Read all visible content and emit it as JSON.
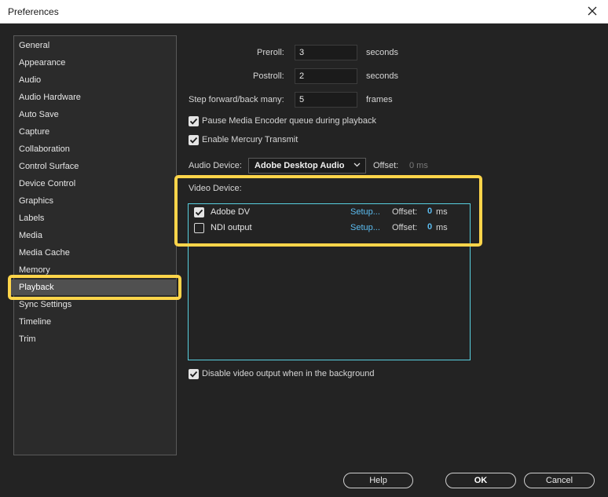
{
  "window": {
    "title": "Preferences"
  },
  "sidebar": {
    "items": [
      {
        "label": "General"
      },
      {
        "label": "Appearance"
      },
      {
        "label": "Audio"
      },
      {
        "label": "Audio Hardware"
      },
      {
        "label": "Auto Save"
      },
      {
        "label": "Capture"
      },
      {
        "label": "Collaboration"
      },
      {
        "label": "Control Surface"
      },
      {
        "label": "Device Control"
      },
      {
        "label": "Graphics"
      },
      {
        "label": "Labels"
      },
      {
        "label": "Media"
      },
      {
        "label": "Media Cache"
      },
      {
        "label": "Memory"
      },
      {
        "label": "Playback"
      },
      {
        "label": "Sync Settings"
      },
      {
        "label": "Timeline"
      },
      {
        "label": "Trim"
      }
    ],
    "selected": "Playback"
  },
  "playback": {
    "preroll": {
      "label": "Preroll:",
      "value": "3",
      "unit": "seconds"
    },
    "postroll": {
      "label": "Postroll:",
      "value": "2",
      "unit": "seconds"
    },
    "step": {
      "label": "Step forward/back many:",
      "value": "5",
      "unit": "frames"
    },
    "pause_encoder": {
      "label": "Pause Media Encoder queue during playback",
      "checked": true
    },
    "mercury": {
      "label": "Enable Mercury Transmit",
      "checked": true
    },
    "audio_device": {
      "label": "Audio Device:",
      "value": "Adobe Desktop Audio",
      "offset_label": "Offset:",
      "offset_value": "0 ms"
    },
    "video_device": {
      "label": "Video Device:",
      "devices": [
        {
          "name": "Adobe DV",
          "checked": true,
          "setup": "Setup...",
          "offset_label": "Offset:",
          "offset": "0",
          "unit": "ms"
        },
        {
          "name": "NDI output",
          "checked": false,
          "setup": "Setup...",
          "offset_label": "Offset:",
          "offset": "0",
          "unit": "ms"
        }
      ]
    },
    "disable_bg": {
      "label": "Disable video output when in the background",
      "checked": true
    }
  },
  "buttons": {
    "help": "Help",
    "ok": "OK",
    "cancel": "Cancel"
  },
  "colors": {
    "highlight": "#ffd54a",
    "accent": "#5bbcf0",
    "list_border": "#58d0e0"
  }
}
